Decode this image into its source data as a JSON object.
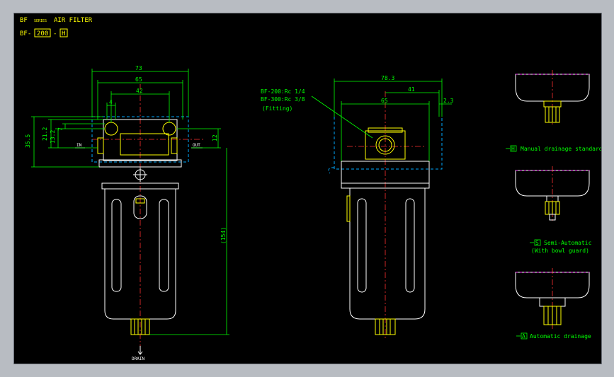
{
  "title": {
    "bf": "BF",
    "series": "SERIES",
    "name": "AIR FILTER",
    "model_prefix": "BF-",
    "model_size": "200",
    "model_sep": "-",
    "model_drain": "H"
  },
  "front_view": {
    "dim_overall_width": "73",
    "dim_body_width": "65",
    "dim_port_pitch": "42",
    "dim_small": "4",
    "dim_height_top": "35.5",
    "dim_21": "21.2",
    "dim_13": "13.2",
    "dim_7": "7",
    "dim_right_12": "12",
    "dim_total_height": "(154)",
    "label_in": "IN",
    "label_out": "OUT",
    "label_drain": "DRAIN"
  },
  "side_view": {
    "dim_overall_width": "78.3",
    "dim_41": "41",
    "dim_65": "65",
    "dim_2_3": "2.3",
    "fitting_line1": "BF-200:Rc 1/4",
    "fitting_line2": "BF-300:Rc 3/8",
    "fitting_line3": "(Fitting)"
  },
  "drain_options": [
    {
      "code": "H",
      "line1": "Manual drainage standard",
      "line2": ""
    },
    {
      "code": "S",
      "line1": "Semi-Automatic",
      "line2": "(With bowl guard)"
    },
    {
      "code": "A",
      "line1": "Automatic drainage",
      "line2": ""
    }
  ],
  "colors": {
    "background": "#000000",
    "outline": "#ffffff",
    "fitting": "#ffff00",
    "dimension": "#00ff00",
    "centerline": "#ff3030",
    "hidden": "#00aaff",
    "magenta": "#ff00ff"
  }
}
